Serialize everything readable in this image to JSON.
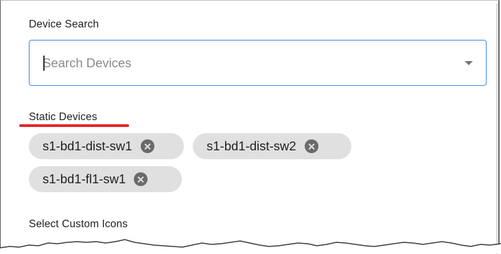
{
  "form": {
    "device_search_label": "Device Search",
    "search_placeholder": "Search Devices",
    "static_devices_label": "Static Devices",
    "custom_icons_label": "Select Custom Icons"
  },
  "static_devices": [
    "s1-bd1-dist-sw1",
    "s1-bd1-dist-sw2",
    "s1-bd1-fl1-sw1"
  ],
  "colors": {
    "focus_border": "#3f86e6",
    "chip_background": "#e0e0e0",
    "annotation_underline": "#e0292b"
  },
  "icons": {
    "dropdown": "dropdown-arrow-icon",
    "chip_remove": "cancel-circle-icon"
  }
}
